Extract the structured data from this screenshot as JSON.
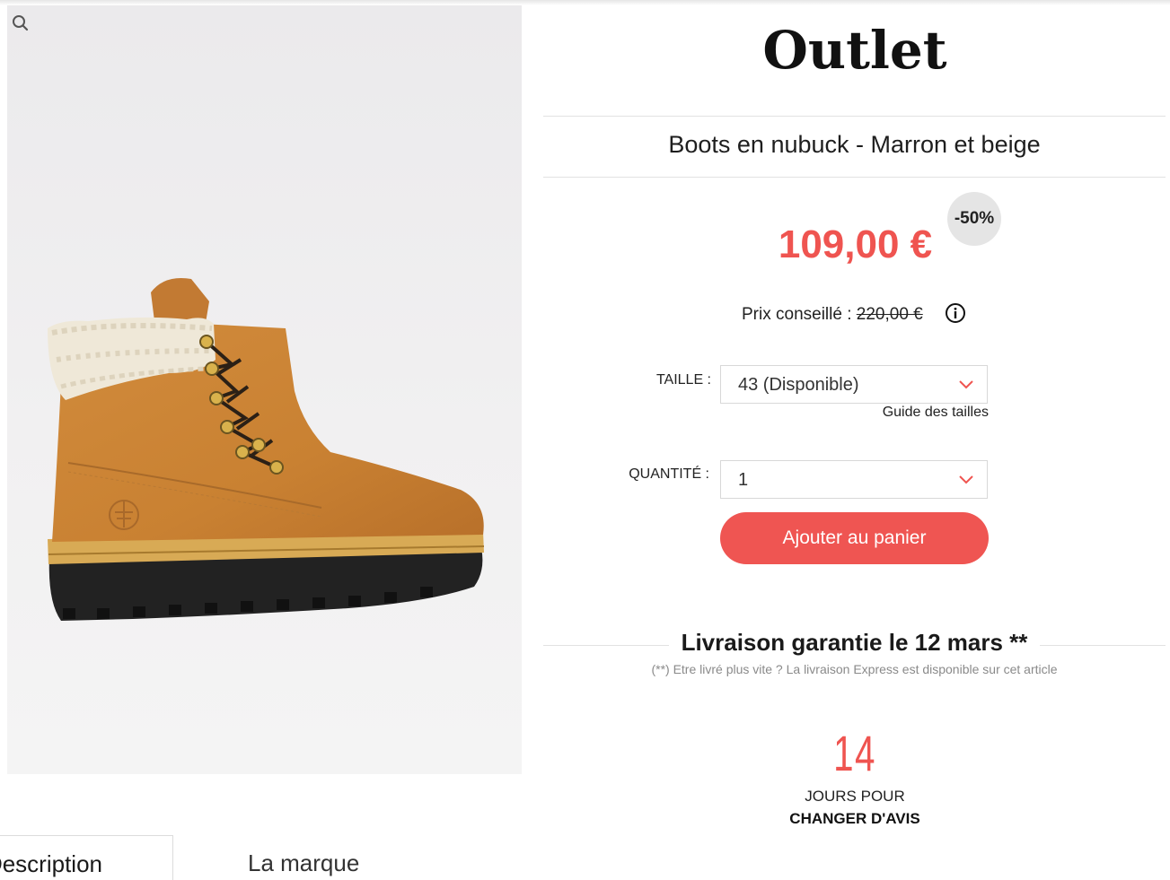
{
  "header": {
    "logo_text": "Outlet"
  },
  "product": {
    "title": "Boots en nubuck - Marron et beige",
    "price": "109,00 €",
    "discount_badge": "-50%",
    "rrp_label": "Prix conseillé : ",
    "rrp_value": "220,00 €"
  },
  "size": {
    "label": "TAILLE :",
    "selected": "43 (Disponible)",
    "guide_link": "Guide des tailles"
  },
  "quantity": {
    "label": "QUANTITÉ :",
    "selected": "1"
  },
  "cart": {
    "button_label": "Ajouter au panier"
  },
  "delivery": {
    "headline": "Livraison garantie le 12 mars **",
    "note": "(**) Etre livré plus vite ? La livraison Express est disponible sur cet article"
  },
  "returns": {
    "days": "14",
    "line1": "JOURS POUR",
    "line2": "CHANGER D'AVIS"
  },
  "tabs": [
    {
      "label": "Description"
    },
    {
      "label": "La marque"
    }
  ],
  "colors": {
    "accent": "#ef5450",
    "badge_bg": "#e5e5e5",
    "border": "#d8d8d8"
  },
  "icons": {
    "zoom": "magnifier-icon",
    "info": "info-icon",
    "select_arrow": "chevron-down-icon"
  }
}
